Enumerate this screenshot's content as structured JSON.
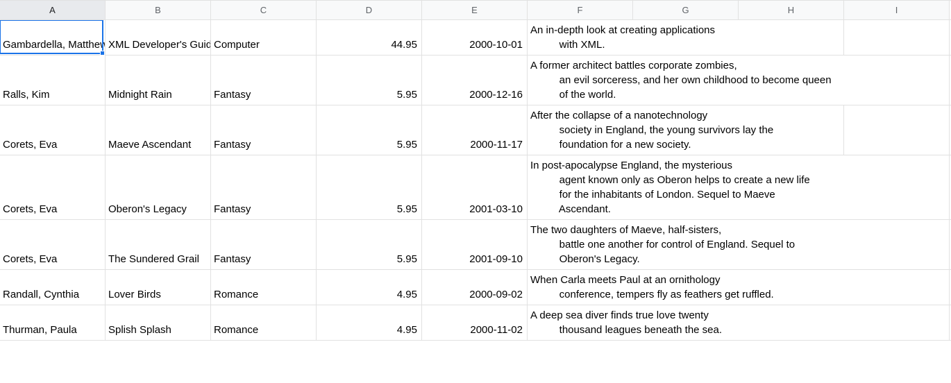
{
  "columns": [
    "A",
    "B",
    "C",
    "D",
    "E",
    "F",
    "G",
    "H",
    "I"
  ],
  "activeColumn": "A",
  "selectedCell": {
    "row": 0,
    "col": 0,
    "width": 152,
    "height": 54
  },
  "rows": [
    {
      "author": "Gambardella, Matthew",
      "title": "XML Developer's Guide",
      "genre": "Computer",
      "price": "44.95",
      "date": "2000-10-01",
      "desc": "An in-depth look at creating applications \n          with XML."
    },
    {
      "author": "Ralls, Kim",
      "title": "Midnight Rain",
      "genre": "Fantasy",
      "price": "5.95",
      "date": "2000-12-16",
      "desc": "A former architect battles corporate zombies, \n          an evil sorceress, and her own childhood to become queen \n          of the world."
    },
    {
      "author": "Corets, Eva",
      "title": "Maeve Ascendant",
      "genre": "Fantasy",
      "price": "5.95",
      "date": "2000-11-17",
      "desc": "After the collapse of a nanotechnology \n          society in England, the young survivors lay the \n          foundation for a new society."
    },
    {
      "author": "Corets, Eva",
      "title": "Oberon's Legacy",
      "genre": "Fantasy",
      "price": "5.95",
      "date": "2001-03-10",
      "desc": "In post-apocalypse England, the mysterious \n          agent known only as Oberon helps to create a new life \n          for the inhabitants of London. Sequel to Maeve \n          Ascendant."
    },
    {
      "author": "Corets, Eva",
      "title": "The Sundered Grail",
      "genre": "Fantasy",
      "price": "5.95",
      "date": "2001-09-10",
      "desc": "The two daughters of Maeve, half-sisters, \n          battle one another for control of England. Sequel to \n          Oberon's Legacy."
    },
    {
      "author": "Randall, Cynthia",
      "title": "Lover Birds",
      "genre": "Romance",
      "price": "4.95",
      "date": "2000-09-02",
      "desc": "When Carla meets Paul at an ornithology \n          conference, tempers fly as feathers get ruffled."
    },
    {
      "author": "Thurman, Paula",
      "title": "Splish Splash",
      "genre": "Romance",
      "price": "4.95",
      "date": "2000-11-02",
      "desc": "A deep sea diver finds true love twenty \n          thousand leagues beneath the sea."
    }
  ]
}
